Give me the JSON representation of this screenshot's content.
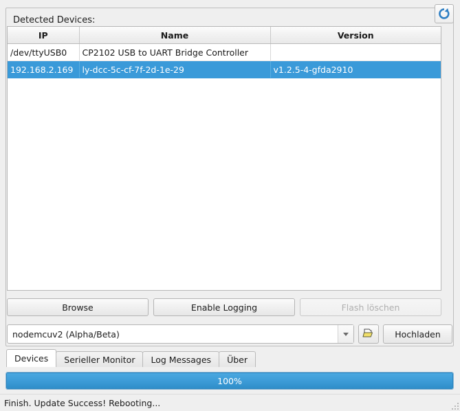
{
  "groupbox": {
    "title": "Detected Devices:"
  },
  "refresh": {
    "icon": "refresh-icon",
    "accent": "#2e7fc4"
  },
  "table": {
    "columns": [
      "IP",
      "Name",
      "Version"
    ],
    "rows": [
      {
        "ip": "/dev/ttyUSB0",
        "name": "CP2102 USB to UART Bridge Controller",
        "version": "",
        "selected": false
      },
      {
        "ip": "192.168.2.169",
        "name": "ly-dcc-5c-cf-7f-2d-1e-29",
        "version": "v1.2.5-4-gfda2910",
        "selected": true
      }
    ],
    "selection_color": "#3a9ad9"
  },
  "buttons": {
    "browse": "Browse",
    "enable_logging": "Enable Logging",
    "flash_erase": "Flash löschen",
    "flash_erase_disabled": true
  },
  "combo": {
    "value": "nodemcuv2 (Alpha/Beta)",
    "arrow_icon": "chevron-down-icon"
  },
  "file_button": {
    "icon": "open-folder-icon"
  },
  "upload_button": {
    "label": "Hochladen"
  },
  "tabs": [
    {
      "label": "Devices",
      "active": true
    },
    {
      "label": "Serieller Monitor",
      "active": false
    },
    {
      "label": "Log Messages",
      "active": false
    },
    {
      "label": "Über",
      "active": false
    }
  ],
  "progress": {
    "label": "100%",
    "value": 100,
    "fill_color": "#3d9cd8"
  },
  "status": {
    "text": "Finish. Update Success! Rebooting..."
  }
}
